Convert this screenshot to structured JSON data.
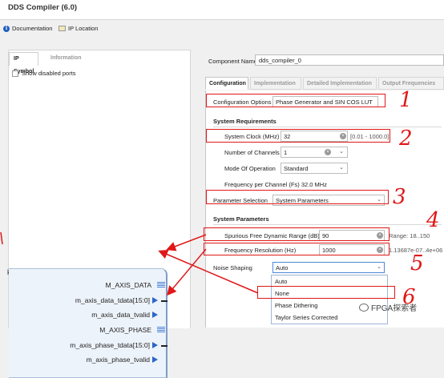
{
  "window": {
    "title": "DDS Compiler (6.0)"
  },
  "toolbar": {
    "documentation": "Documentation",
    "ip_location": "IP Location"
  },
  "left_panel": {
    "tabs": [
      "IP Symbol",
      "Information"
    ],
    "show_disabled_ports": "Show disabled ports",
    "edge_char": "k",
    "ports": [
      {
        "label": "M_AXIS_DATA",
        "kind": "bus"
      },
      {
        "label": "m_axis_data_tdata[15:0]",
        "kind": "signal"
      },
      {
        "label": "m_axis_data_tvalid",
        "kind": "signal"
      },
      {
        "label": "M_AXIS_PHASE",
        "kind": "bus"
      },
      {
        "label": "m_axis_phase_tdata[15:0]",
        "kind": "signal"
      },
      {
        "label": "m_axis_phase_tvalid",
        "kind": "signal"
      }
    ]
  },
  "right_panel": {
    "component_name_label": "Component Name",
    "component_name_value": "dds_compiler_0",
    "tabs": [
      "Configuration",
      "Implementation",
      "Detailed Implementation",
      "Output Frequencies"
    ],
    "configuration_options_label": "Configuration Options",
    "configuration_options_value": "Phase Generator and SIN COS LUT",
    "system_requirements_header": "System Requirements",
    "system_clock_label": "System Clock (MHz)",
    "system_clock_value": "32",
    "system_clock_range": "[0.01 - 1000.0]",
    "num_channels_label": "Number of Channels",
    "num_channels_value": "1",
    "mode_label": "Mode Of Operation",
    "mode_value": "Standard",
    "freq_per_channel": "Frequency per Channel (Fs) 32.0 MHz",
    "param_selection_label": "Parameter Selection",
    "param_selection_value": "System Parameters",
    "system_parameters_header": "System Parameters",
    "sfdr_label": "Spurious Free Dynamic Range (dB)",
    "sfdr_value": "90",
    "sfdr_range": "Range: 18..150",
    "freq_res_label": "Frequency Resolution (Hz)",
    "freq_res_value": "1000",
    "freq_res_range": "1.13687e-07..4e+06",
    "noise_shaping_label": "Noise Shaping",
    "noise_shaping_value": "Auto",
    "noise_shaping_options": [
      "Auto",
      "None",
      "Phase Dithering",
      "Taylor Series Corrected"
    ]
  },
  "annotations": {
    "numbers": [
      "1",
      "2",
      "3",
      "4",
      "5",
      "6"
    ]
  },
  "watermark": {
    "text": "FPGA探索者"
  },
  "colors": {
    "annotation_red": "#e01818",
    "port_blue": "#2a67c9",
    "focus_blue": "#4a8ad8"
  }
}
